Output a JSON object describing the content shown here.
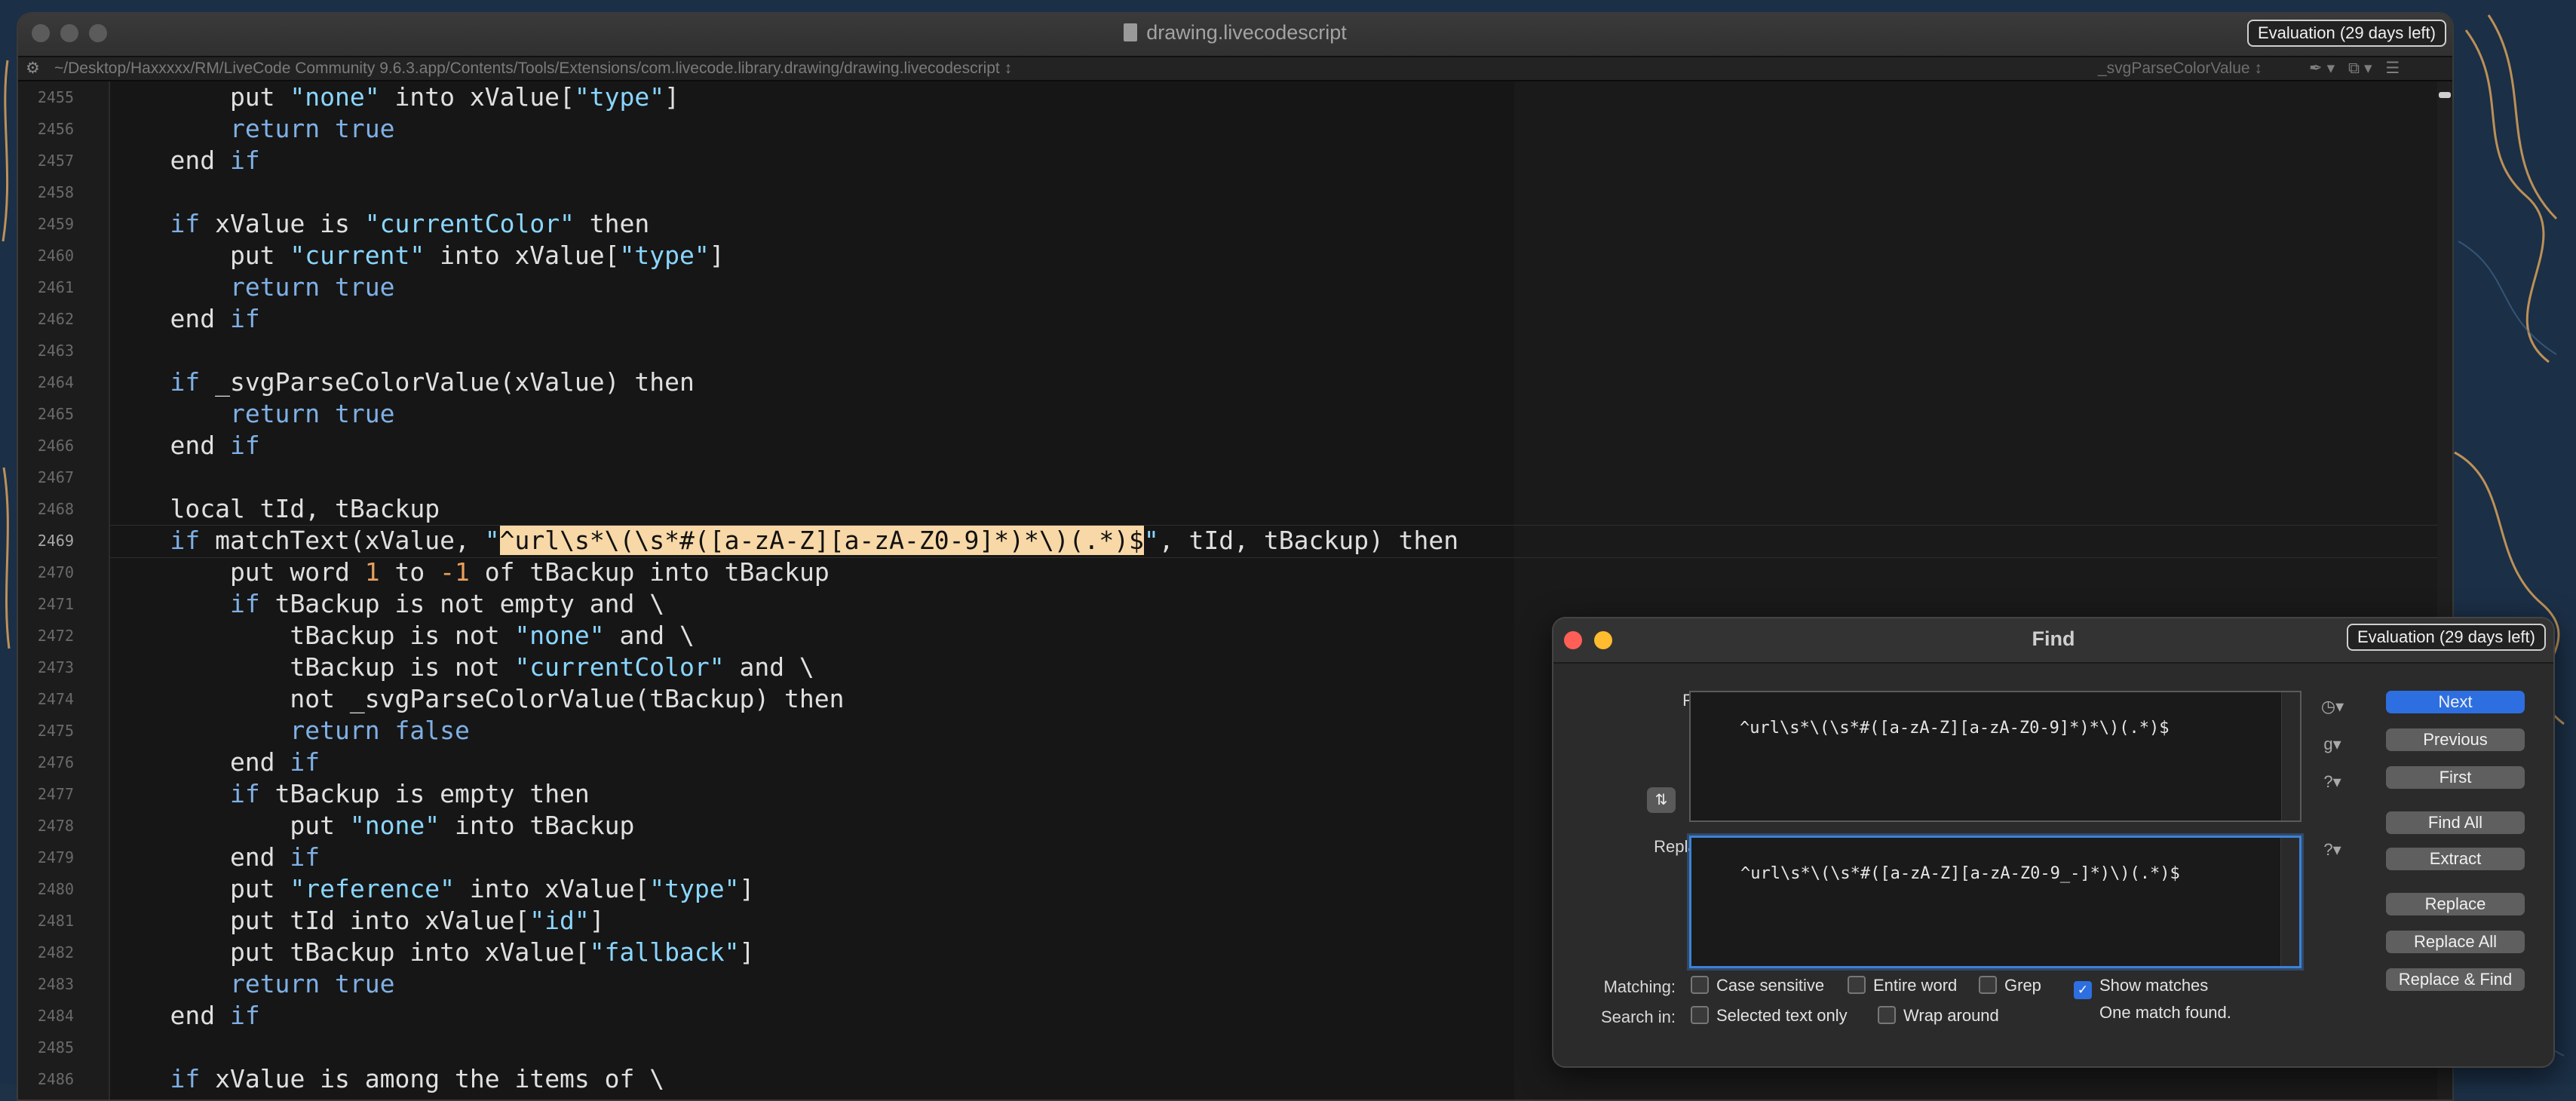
{
  "window": {
    "title": "drawing.livecodescript",
    "evaluation_badge": "Evaluation (29 days left)",
    "path": "~/Desktop/Haxxxxx/RM/LiveCode Community 9.6.3.app/Contents/Tools/Extensions/com.livecode.library.drawing/drawing.livecodescript ↕",
    "handler": "_svgParseColorValue ↕",
    "pathbar_icons": "✒▾ ⧉▾ ☰"
  },
  "editor": {
    "line_numbers": [
      "2455",
      "2456",
      "2457",
      "2458",
      "2459",
      "2460",
      "2461",
      "2462",
      "2463",
      "2464",
      "2465",
      "2466",
      "2467",
      "2468",
      "2469",
      "2470",
      "2471",
      "2472",
      "2473",
      "2474",
      "2475",
      "2476",
      "2477",
      "2478",
      "2479",
      "2480",
      "2481",
      "2482",
      "2483",
      "2484",
      "2485",
      "2486"
    ],
    "current_line": "2469",
    "lines": [
      [
        {
          "t": "        put "
        },
        {
          "t": "\"none\"",
          "c": "str"
        },
        {
          "t": " into xValue["
        },
        {
          "t": "\"type\"",
          "c": "str"
        },
        {
          "t": "]"
        }
      ],
      [
        {
          "t": "        "
        },
        {
          "t": "return",
          "c": "kw"
        },
        {
          "t": " "
        },
        {
          "t": "true",
          "c": "kw"
        }
      ],
      [
        {
          "t": "    end "
        },
        {
          "t": "if",
          "c": "kw"
        }
      ],
      [],
      [
        {
          "t": "    "
        },
        {
          "t": "if",
          "c": "kw"
        },
        {
          "t": " xValue is "
        },
        {
          "t": "\"currentColor\"",
          "c": "str"
        },
        {
          "t": " then"
        }
      ],
      [
        {
          "t": "        put "
        },
        {
          "t": "\"current\"",
          "c": "str"
        },
        {
          "t": " into xValue["
        },
        {
          "t": "\"type\"",
          "c": "str"
        },
        {
          "t": "]"
        }
      ],
      [
        {
          "t": "        "
        },
        {
          "t": "return",
          "c": "kw"
        },
        {
          "t": " "
        },
        {
          "t": "true",
          "c": "kw"
        }
      ],
      [
        {
          "t": "    end "
        },
        {
          "t": "if",
          "c": "kw"
        }
      ],
      [],
      [
        {
          "t": "    "
        },
        {
          "t": "if",
          "c": "kw"
        },
        {
          "t": " _svgParseColorValue(xValue) then"
        }
      ],
      [
        {
          "t": "        "
        },
        {
          "t": "return",
          "c": "kw"
        },
        {
          "t": " "
        },
        {
          "t": "true",
          "c": "kw"
        }
      ],
      [
        {
          "t": "    end "
        },
        {
          "t": "if",
          "c": "kw"
        }
      ],
      [],
      [
        {
          "t": "    local tId, tBackup"
        }
      ],
      [
        {
          "t": "    "
        },
        {
          "t": "if",
          "c": "kw"
        },
        {
          "t": " matchText(xValue, "
        },
        {
          "t": "\"",
          "c": "str"
        },
        {
          "t": "^url\\s*\\(\\s*#([a-zA-Z][a-zA-Z0-9]*)*\\)(.*)$",
          "c": "hl"
        },
        {
          "t": "\"",
          "c": "str"
        },
        {
          "t": ", tId, tBackup) then"
        }
      ],
      [
        {
          "t": "        put word "
        },
        {
          "t": "1",
          "c": "num"
        },
        {
          "t": " to "
        },
        {
          "t": "-1",
          "c": "num"
        },
        {
          "t": " of tBackup into tBackup"
        }
      ],
      [
        {
          "t": "        "
        },
        {
          "t": "if",
          "c": "kw"
        },
        {
          "t": " tBackup is not empty and \\"
        }
      ],
      [
        {
          "t": "            tBackup is not "
        },
        {
          "t": "\"none\"",
          "c": "str"
        },
        {
          "t": " and \\"
        }
      ],
      [
        {
          "t": "            tBackup is not "
        },
        {
          "t": "\"currentColor\"",
          "c": "str"
        },
        {
          "t": " and \\"
        }
      ],
      [
        {
          "t": "            not _svgParseColorValue(tBackup) then"
        }
      ],
      [
        {
          "t": "            "
        },
        {
          "t": "return",
          "c": "kw"
        },
        {
          "t": " "
        },
        {
          "t": "false",
          "c": "kw"
        }
      ],
      [
        {
          "t": "        end "
        },
        {
          "t": "if",
          "c": "kw"
        }
      ],
      [
        {
          "t": "        "
        },
        {
          "t": "if",
          "c": "kw"
        },
        {
          "t": " tBackup is empty then"
        }
      ],
      [
        {
          "t": "            put "
        },
        {
          "t": "\"none\"",
          "c": "str"
        },
        {
          "t": " into tBackup"
        }
      ],
      [
        {
          "t": "        end "
        },
        {
          "t": "if",
          "c": "kw"
        }
      ],
      [
        {
          "t": "        put "
        },
        {
          "t": "\"reference\"",
          "c": "str"
        },
        {
          "t": " into xValue["
        },
        {
          "t": "\"type\"",
          "c": "str"
        },
        {
          "t": "]"
        }
      ],
      [
        {
          "t": "        put tId into xValue["
        },
        {
          "t": "\"id\"",
          "c": "str"
        },
        {
          "t": "]"
        }
      ],
      [
        {
          "t": "        put tBackup into xValue["
        },
        {
          "t": "\"fallback\"",
          "c": "str"
        },
        {
          "t": "]"
        }
      ],
      [
        {
          "t": "        "
        },
        {
          "t": "return",
          "c": "kw"
        },
        {
          "t": " "
        },
        {
          "t": "true",
          "c": "kw"
        }
      ],
      [
        {
          "t": "    end "
        },
        {
          "t": "if",
          "c": "kw"
        }
      ],
      [],
      [
        {
          "t": "    "
        },
        {
          "t": "if",
          "c": "kw"
        },
        {
          "t": " xValue is among the items of \\"
        }
      ]
    ]
  },
  "find_dialog": {
    "title": "Find",
    "evaluation_badge": "Evaluation (29 days left)",
    "find_label": "Find:",
    "find_value": "^url\\s*\\(\\s*#([a-zA-Z][a-zA-Z0-9]*)*\\)(.*)$",
    "replace_label": "Replace:",
    "replace_value": "^url\\s*\\(\\s*#([a-zA-Z][a-zA-Z0-9_-]*)\\)(.*)$",
    "grep_toggle": "⇅",
    "mini_icons": {
      "history": "◷▾",
      "grep": "g▾",
      "help": "?▾",
      "replace_help": "?▾"
    },
    "buttons": [
      "Next",
      "Previous",
      "First",
      "Find All",
      "Extract",
      "Replace",
      "Replace All",
      "Replace & Find"
    ],
    "matching_label": "Matching:",
    "search_in_label": "Search in:",
    "options": {
      "case_sensitive": {
        "label": "Case sensitive",
        "checked": false
      },
      "entire_word": {
        "label": "Entire word",
        "checked": false
      },
      "grep": {
        "label": "Grep",
        "checked": false
      },
      "show_matches": {
        "label": "Show matches",
        "checked": true
      },
      "selected_text_only": {
        "label": "Selected text only",
        "checked": false
      },
      "wrap_around": {
        "label": "Wrap around",
        "checked": false
      }
    },
    "status": "One match found."
  },
  "colors": {
    "accent": "#2d6fe0",
    "highlight": "#f7d8a6",
    "keyword": "#7fb0e6",
    "string": "#8ad6ff",
    "number": "#e8a05c"
  }
}
